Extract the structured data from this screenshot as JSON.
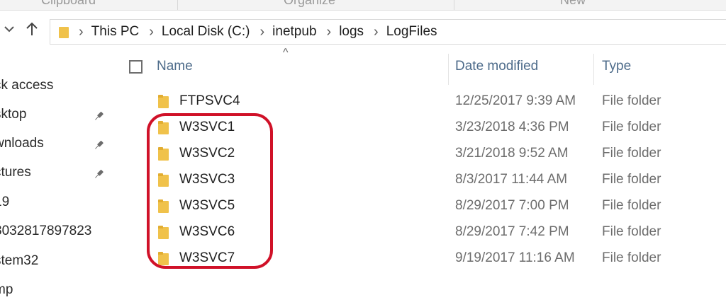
{
  "ribbon": {
    "labels": [
      "Clipboard",
      "Organize",
      "New"
    ]
  },
  "address": {
    "breadcrumbs": [
      "This PC",
      "Local Disk (C:)",
      "inetpub",
      "logs",
      "LogFiles"
    ]
  },
  "nav": {
    "up_icon": "up-arrow-icon",
    "recent_icon": "chevron-down-icon"
  },
  "sidebar": {
    "items": [
      {
        "label": "ck access",
        "pinned": false
      },
      {
        "label": "sktop",
        "pinned": true
      },
      {
        "label": "wnloads",
        "pinned": true
      },
      {
        "label": "ctures",
        "pinned": true
      },
      {
        "label": "19",
        "pinned": false
      },
      {
        "label": "8032817897823",
        "pinned": false
      },
      {
        "label": "stem32",
        "pinned": false
      },
      {
        "label": "mp",
        "pinned": false
      }
    ]
  },
  "columns": {
    "name": "Name",
    "date": "Date modified",
    "type": "Type"
  },
  "files": [
    {
      "name": "FTPSVC4",
      "date": "12/25/2017 9:39 AM",
      "type": "File folder"
    },
    {
      "name": "W3SVC1",
      "date": "3/23/2018 4:36 PM",
      "type": "File folder"
    },
    {
      "name": "W3SVC2",
      "date": "3/21/2018 9:52 AM",
      "type": "File folder"
    },
    {
      "name": "W3SVC3",
      "date": "8/3/2017 11:44 AM",
      "type": "File folder"
    },
    {
      "name": "W3SVC5",
      "date": "8/29/2017 7:00 PM",
      "type": "File folder"
    },
    {
      "name": "W3SVC6",
      "date": "8/29/2017 7:42 PM",
      "type": "File folder"
    },
    {
      "name": "W3SVC7",
      "date": "9/19/2017 11:16 AM",
      "type": "File folder"
    }
  ],
  "colors": {
    "folder": "#f0c24b",
    "annotation": "#d01128",
    "header_text": "#4d6b8a"
  }
}
